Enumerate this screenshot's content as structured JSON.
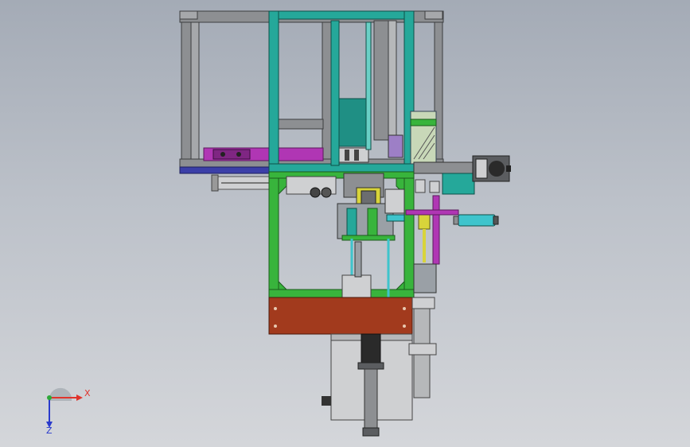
{
  "colors": {
    "frame_gray": "#8d8f92",
    "frame_dark": "#5b5d60",
    "teal_frame": "#25a89a",
    "green_frame": "#38b43c",
    "magenta_plate": "#b036b4",
    "navy_rail": "#3b3fa8",
    "rust_plate": "#a23a1d",
    "cyan_cylinder": "#3ec4cc",
    "yellow_cylinder": "#d8d43a",
    "steel_light": "#cfd0d2",
    "axis_x": "#e0342c",
    "axis_y": "#2ea83a",
    "axis_z": "#2a3acc"
  },
  "triad": {
    "x_label": "X",
    "z_label": "Z"
  },
  "icons": {
    "triad": "coordinate-triad-icon"
  }
}
